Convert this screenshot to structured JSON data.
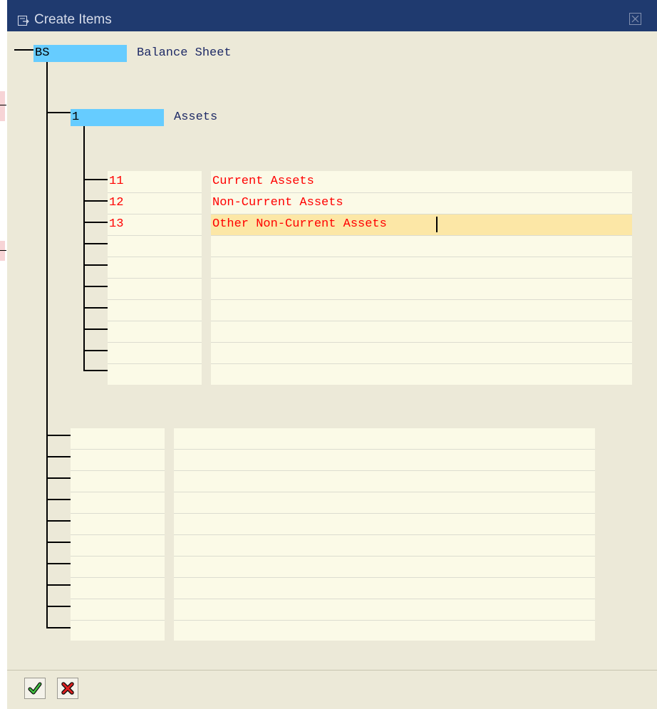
{
  "window": {
    "title": "Create Items"
  },
  "tree": {
    "root": {
      "key": "BS",
      "text": "Balance Sheet"
    },
    "child": {
      "key": "1",
      "text": "Assets"
    }
  },
  "items_table": {
    "rows": [
      {
        "key": "11",
        "text": "Current Assets"
      },
      {
        "key": "12",
        "text": "Non-Current Assets"
      },
      {
        "key": "13",
        "text": "Other Non-Current Assets"
      },
      {
        "key": "",
        "text": ""
      },
      {
        "key": "",
        "text": ""
      },
      {
        "key": "",
        "text": ""
      },
      {
        "key": "",
        "text": ""
      },
      {
        "key": "",
        "text": ""
      },
      {
        "key": "",
        "text": ""
      },
      {
        "key": "",
        "text": ""
      }
    ]
  },
  "lower_table": {
    "row_count": 10
  },
  "footer": {
    "confirm_icon": "check-icon",
    "cancel_icon": "x-icon"
  },
  "colors": {
    "title_bar": "#1f3a6f",
    "node_highlight": "#66ccff",
    "entry_text": "#ff0000",
    "input_bg": "#fbfae7",
    "focus_bg": "#fce7a6"
  }
}
